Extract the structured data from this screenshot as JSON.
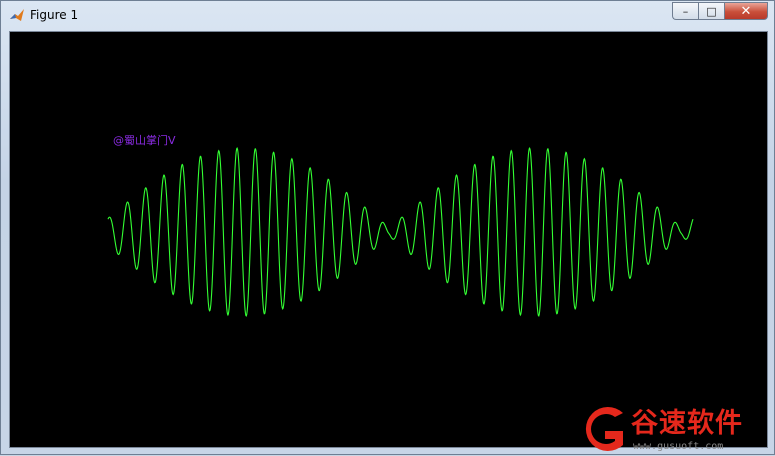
{
  "window": {
    "title": "Figure 1",
    "minimize_label": "–",
    "maximize_label": "□",
    "close_label": "✕"
  },
  "figure": {
    "background": "#000000",
    "line_color": "#33ff33",
    "annotation": "@蜀山掌门V",
    "annotation_color": "#8a2be2"
  },
  "chart_data": {
    "type": "line",
    "title": "",
    "xlabel": "",
    "ylabel": "",
    "axes_visible": false,
    "grid": false,
    "description_of_signal": "amplitude-modulated sinusoid, two envelope lobes",
    "carrier_cycles": 32,
    "envelope_lobes": 2,
    "peak_amplitude": 1.0
  },
  "watermark": {
    "brand": "谷速软件",
    "url": "www.gusuoft.com",
    "color": "#e5281c"
  }
}
